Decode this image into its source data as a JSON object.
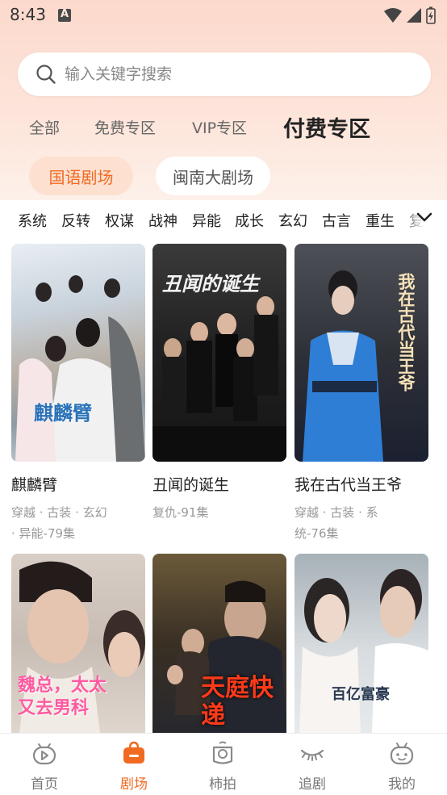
{
  "status": {
    "time": "8:43"
  },
  "search": {
    "placeholder": "输入关键字搜索"
  },
  "zones": [
    {
      "label": "全部",
      "active": false
    },
    {
      "label": "免费专区",
      "active": false
    },
    {
      "label": "VIP专区",
      "active": false
    },
    {
      "label": "付费专区",
      "active": true
    }
  ],
  "languages": [
    {
      "label": "国语剧场",
      "active": true
    },
    {
      "label": "闽南大剧场",
      "active": false
    }
  ],
  "genres": [
    "系统",
    "反转",
    "权谋",
    "战神",
    "异能",
    "成长",
    "玄幻",
    "古言",
    "重生",
    "复"
  ],
  "dramas": [
    {
      "title": "麒麟臂",
      "meta_line1": "穿越 · 古装 · 玄幻",
      "meta_line2": "· 异能-79集",
      "poster_text": "麒麟臂"
    },
    {
      "title": "丑闻的诞生",
      "meta_line1": "复仇-91集",
      "meta_line2": "",
      "poster_text": "丑闻的诞生"
    },
    {
      "title": "我在古代当王爷",
      "meta_line1": "穿越 · 古装 · 系",
      "meta_line2": "统-76集",
      "poster_text": "我在古代当王爷"
    },
    {
      "title": "",
      "meta_line1": "",
      "meta_line2": "",
      "poster_text": "魏总，太太又去男科"
    },
    {
      "title": "",
      "meta_line1": "",
      "meta_line2": "",
      "poster_text": "天庭快递"
    },
    {
      "title": "",
      "meta_line1": "",
      "meta_line2": "",
      "poster_text": "百亿富豪"
    }
  ],
  "nav": [
    {
      "label": "首页",
      "icon": "home-play-icon",
      "active": false
    },
    {
      "label": "剧场",
      "icon": "theater-bag-icon",
      "active": true
    },
    {
      "label": "柿拍",
      "icon": "camera-persimmon-icon",
      "active": false
    },
    {
      "label": "追剧",
      "icon": "eye-closed-icon",
      "active": false
    },
    {
      "label": "我的",
      "icon": "robot-face-icon",
      "active": false
    }
  ],
  "colors": {
    "accent": "#f06a22",
    "accent_bg": "#fde0d0"
  }
}
